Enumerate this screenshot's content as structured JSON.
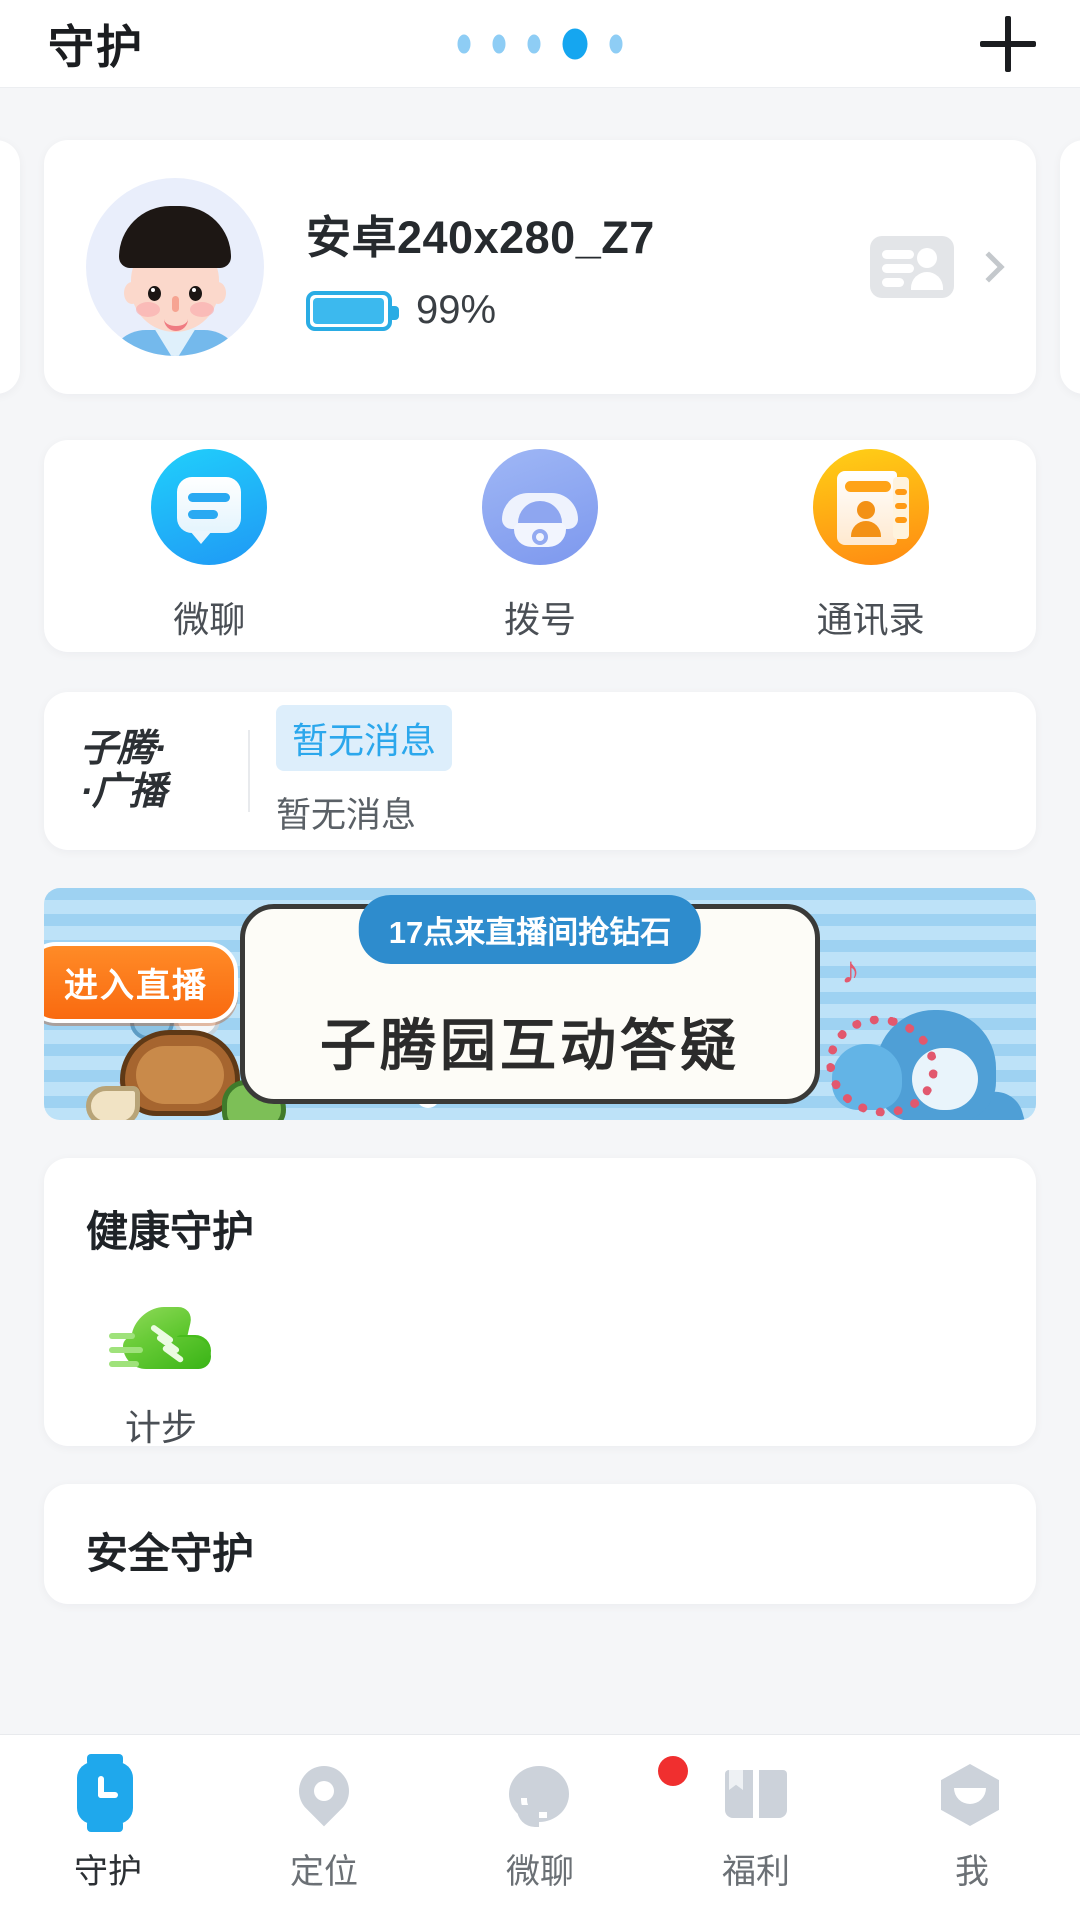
{
  "header": {
    "title": "守护",
    "add_label": "+",
    "pager": {
      "total": 5,
      "active_index": 3
    }
  },
  "device_card": {
    "name": "安卓240x280_Z7",
    "battery_percent": "99%",
    "battery_level": 99,
    "avatar_name": "boy-avatar",
    "idcard_icon": "id-card-icon",
    "chevron_icon": "chevron-right-icon"
  },
  "quick_actions": [
    {
      "label": "微聊",
      "icon": "chat-icon"
    },
    {
      "label": "拨号",
      "icon": "dial-icon"
    },
    {
      "label": "通讯录",
      "icon": "contacts-icon"
    }
  ],
  "broadcast": {
    "logo_line1": "子腾·",
    "logo_line2": "·广播",
    "badge": "暂无消息",
    "subtitle": "暂无消息",
    "badge_color": "#2ba7ec",
    "badge_bg": "#ddeefb"
  },
  "banner": {
    "live_label": "进入直播",
    "pill_label": "17点来直播间抢钻石",
    "title": "子腾园互动答疑",
    "live_bg": "#f96a10",
    "pill_bg": "#2e8ccd"
  },
  "health": {
    "title": "健康守护",
    "tiles": [
      {
        "label": "计步",
        "icon": "running-shoe-icon"
      }
    ]
  },
  "safety": {
    "title": "安全守护"
  },
  "bottom_nav": {
    "active_index": 0,
    "accent": "#1fa8ec",
    "items": [
      {
        "label": "守护",
        "icon": "watch-icon",
        "badge": false
      },
      {
        "label": "定位",
        "icon": "location-pin-icon",
        "badge": false
      },
      {
        "label": "微聊",
        "icon": "chat-bubble-icon",
        "badge": false
      },
      {
        "label": "福利",
        "icon": "book-icon",
        "badge": true
      },
      {
        "label": "我",
        "icon": "profile-hex-icon",
        "badge": false
      }
    ]
  }
}
